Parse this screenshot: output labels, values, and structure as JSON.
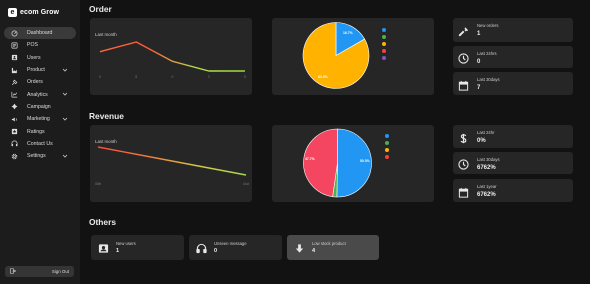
{
  "app": {
    "logo_mark": "e",
    "logo_text": "ecom Grow"
  },
  "sidebar": {
    "items": [
      {
        "label": "Dashboard",
        "icon": "dashboard-icon",
        "active": true
      },
      {
        "label": "POS",
        "icon": "pos-icon"
      },
      {
        "label": "Users",
        "icon": "users-icon"
      },
      {
        "label": "Product",
        "icon": "product-icon",
        "expandable": true
      },
      {
        "label": "Orders",
        "icon": "orders-icon"
      },
      {
        "label": "Analytics",
        "icon": "analytics-icon",
        "expandable": true
      },
      {
        "label": "Campaign",
        "icon": "campaign-icon"
      },
      {
        "label": "Marketing",
        "icon": "marketing-icon",
        "expandable": true
      },
      {
        "label": "Ratings",
        "icon": "ratings-icon"
      },
      {
        "label": "Contact Us",
        "icon": "contact-icon"
      },
      {
        "label": "Settings",
        "icon": "settings-icon",
        "expandable": true
      }
    ],
    "signout_label": "Sign Out"
  },
  "sections": {
    "order": "Order",
    "revenue": "Revenue",
    "others": "Others"
  },
  "order": {
    "line_label": "Last month",
    "x_ticks": [
      "0",
      "5",
      "0",
      "0",
      "5"
    ],
    "pie_labels": [
      "16.7%",
      "83.3%"
    ],
    "legend_colors": [
      "#2196f3",
      "#4caf50",
      "#ffb300",
      "#f44336",
      "#7e57c2"
    ],
    "stats": [
      {
        "label": "New orders",
        "value": "1",
        "icon": "hammer-icon"
      },
      {
        "label": "Last 24hrs",
        "value": "0",
        "icon": "clock-icon"
      },
      {
        "label": "Last 30days",
        "value": "7",
        "icon": "calendar-icon"
      }
    ]
  },
  "revenue": {
    "line_label": "Last month",
    "x_ticks": [
      "40th",
      "41st"
    ],
    "pie_labels": [
      "47.7%",
      "50.3%"
    ],
    "legend_colors": [
      "#2196f3",
      "#4caf50",
      "#ffb300",
      "#f44336"
    ],
    "stats": [
      {
        "label": "Last 24hr",
        "value": "0%",
        "icon": "dollar-icon"
      },
      {
        "label": "Last 30days",
        "value": "6762%",
        "icon": "clock-icon"
      },
      {
        "label": "Last 1year",
        "value": "6762%",
        "icon": "calendar-icon"
      }
    ]
  },
  "others": [
    {
      "label": "New users",
      "value": "1",
      "icon": "user-card-icon"
    },
    {
      "label": "Unseen message",
      "value": "0",
      "icon": "headset-icon"
    },
    {
      "label": "Low stock product",
      "value": "4",
      "icon": "arrow-down-icon"
    }
  ],
  "chart_data": [
    {
      "type": "line",
      "label": "Last month",
      "x": [
        "0",
        "5",
        "0",
        "0",
        "5"
      ],
      "series": [
        {
          "values": [
            2,
            3,
            1,
            0,
            0
          ]
        }
      ]
    },
    {
      "type": "pie",
      "slices": [
        {
          "value": 16.7,
          "color": "#2196f3"
        },
        {
          "value": 83.3,
          "color": "#ffb300"
        }
      ]
    },
    {
      "type": "line",
      "label": "Last month",
      "x": [
        "40th",
        "41st"
      ],
      "series": [
        {
          "values": [
            1,
            0
          ]
        }
      ]
    },
    {
      "type": "pie",
      "slices": [
        {
          "value": 50.3,
          "color": "#2196f3"
        },
        {
          "value": 2.0,
          "color": "#4caf50"
        },
        {
          "value": 47.7,
          "color": "#f44660"
        }
      ]
    }
  ]
}
